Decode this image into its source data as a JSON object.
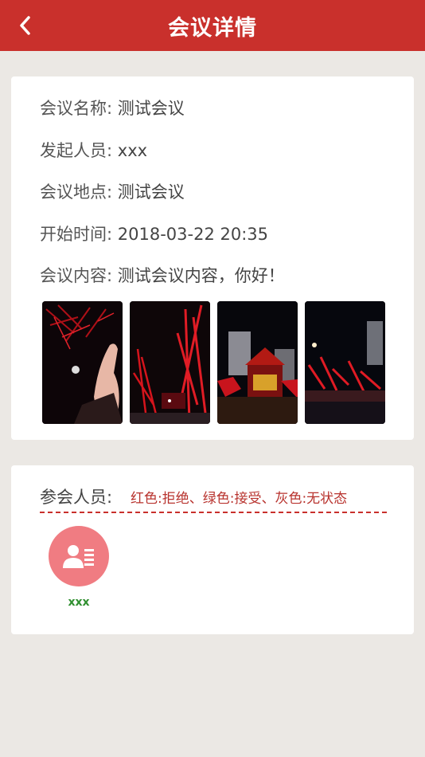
{
  "header": {
    "title": "会议详情",
    "back_icon": "chevron-left-icon"
  },
  "details": {
    "name": {
      "label": "会议名称:",
      "value": "测试会议"
    },
    "initiator": {
      "label": "发起人员:",
      "value": "xxx"
    },
    "location": {
      "label": "会议地点:",
      "value": "测试会议"
    },
    "start_time": {
      "label": "开始时间:",
      "value": "2018-03-22 20:35"
    },
    "content": {
      "label": "会议内容:",
      "value": "测试会议内容，你好！"
    }
  },
  "attendees": {
    "label": "参会人员:",
    "legend": "红色:拒绝、绿色:接受、灰色:无状态",
    "members": [
      {
        "name": "xxx",
        "status_color": "#2f8f2f"
      }
    ]
  },
  "colors": {
    "header": "#c9302c",
    "background": "#ebe8e4",
    "avatar": "#f07c82"
  }
}
